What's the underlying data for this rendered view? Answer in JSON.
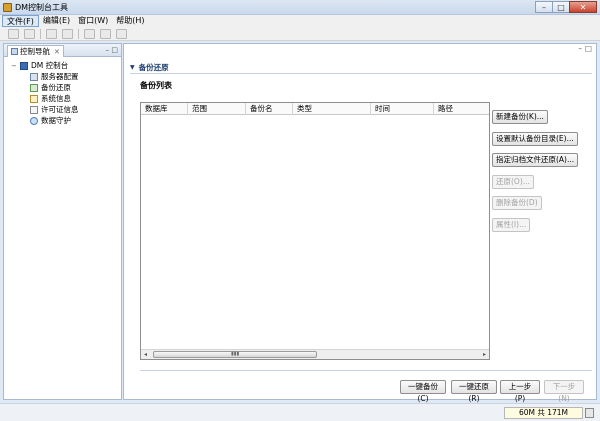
{
  "window": {
    "title": "DM控制台工具",
    "controls": {
      "minimize": "–",
      "maximize": "□",
      "close": "✕"
    }
  },
  "menu": [
    "文件(F)",
    "编辑(E)",
    "窗口(W)",
    "帮助(H)"
  ],
  "toolbar": {
    "icons": [
      "new-icon",
      "save-icon",
      "undo-icon",
      "redo-icon",
      "cut-icon",
      "copy-icon",
      "paste-icon"
    ]
  },
  "nav_view": {
    "tab_label": "控制导航",
    "tab_close": "✕",
    "min_glyph": "–",
    "max_glyph": "□",
    "root_label": "DM 控制台",
    "items": [
      "服务器配置",
      "备份还原",
      "系统信息",
      "许可证信息",
      "数据守护"
    ]
  },
  "editor": {
    "min_glyph": "–",
    "max_glyph": "□",
    "section_title": "备份还原",
    "subtitle": "备份列表",
    "columns": [
      "数据库",
      "范围",
      "备份名",
      "类型",
      "时间",
      "路径"
    ],
    "scroll": {
      "left": "◂",
      "right": "▸",
      "grip": "▮▮▮"
    },
    "side_buttons": [
      {
        "label": "新建备份(K)...",
        "enabled": true
      },
      {
        "label": "设置默认备份目录(E)...",
        "enabled": true
      },
      {
        "label": "指定归档文件还原(A)...",
        "enabled": true
      },
      {
        "label": "还原(O)...",
        "enabled": false
      },
      {
        "label": "删除备份(D)",
        "enabled": false
      },
      {
        "label": "属性(I)...",
        "enabled": false
      }
    ],
    "bottom_buttons": [
      {
        "label": "一键备份(C)",
        "enabled": true
      },
      {
        "label": "一键还原(R)",
        "enabled": true
      },
      {
        "label": "上一步(P)",
        "enabled": true
      },
      {
        "label": "下一步(N)",
        "enabled": false
      }
    ]
  },
  "status": {
    "memory": "60M 共 171M"
  }
}
